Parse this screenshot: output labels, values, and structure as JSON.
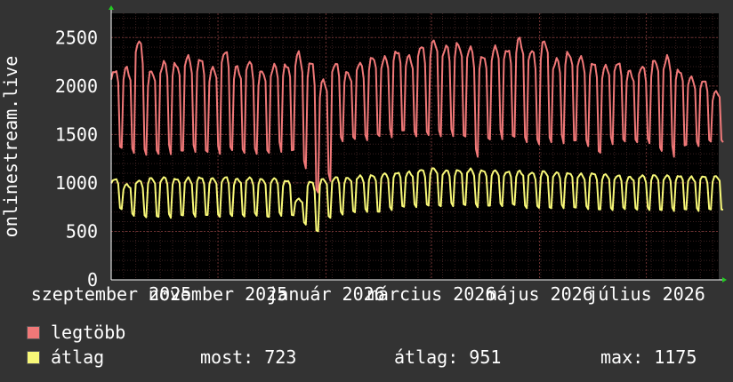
{
  "chart_data": {
    "type": "line",
    "ylabel": "onlinestream.live",
    "ylim": [
      0,
      2750
    ],
    "yticks": [
      0,
      500,
      1000,
      1500,
      2000,
      2500
    ],
    "xticks": [
      "szeptember 2025",
      "november 2025",
      "január 2026",
      "március 2026",
      "május 2026",
      "július 2026"
    ],
    "x_unit": "week",
    "x_range_weeks": [
      0,
      49.5
    ],
    "grid": true,
    "background": "#000000",
    "series": [
      {
        "name": "legtöbb",
        "color": "#f07878",
        "weekly_peak": [
          2180,
          2200,
          2460,
          2150,
          2260,
          2250,
          2320,
          2270,
          2200,
          2380,
          2210,
          2250,
          2150,
          2230,
          2240,
          2360,
          2240,
          2070,
          2250,
          2150,
          2240,
          2290,
          2310,
          2380,
          2320,
          2400,
          2470,
          2430,
          2450,
          2410,
          2300,
          2420,
          2400,
          2500,
          2360,
          2460,
          2290,
          2360,
          2310,
          2230,
          2220,
          2260,
          2160,
          2200,
          2260,
          2320,
          2180,
          2100,
          2050,
          1950
        ],
        "weekly_low": [
          1320,
          1310,
          1290,
          1300,
          1290,
          1300,
          1320,
          1310,
          1300,
          1290,
          1310,
          1300,
          1310,
          1320,
          1300,
          1150,
          890,
          1020,
          1400,
          1450,
          1440,
          1480,
          1470,
          1500,
          1480,
          1490,
          1480,
          1460,
          1460,
          1270,
          1440,
          1450,
          1430,
          1420,
          1400,
          1420,
          1400,
          1410,
          1380,
          1300,
          1400,
          1390,
          1420,
          1410,
          1330,
          1270,
          1360,
          1380,
          1420,
          1400
        ],
        "final_value": 1420
      },
      {
        "name": "átlag",
        "color": "#f8f878",
        "weekly_peak": [
          1040,
          990,
          1030,
          1050,
          1060,
          1050,
          1060,
          1060,
          1050,
          1060,
          1050,
          1060,
          1040,
          1050,
          1030,
          840,
          1020,
          1040,
          1060,
          1060,
          1080,
          1080,
          1100,
          1110,
          1120,
          1140,
          1150,
          1130,
          1140,
          1150,
          1130,
          1130,
          1120,
          1130,
          1110,
          1120,
          1110,
          1110,
          1100,
          1100,
          1090,
          1080,
          1070,
          1080,
          1080,
          1080,
          1080,
          1070,
          1070,
          1070
        ],
        "weekly_low": [
          720,
          660,
          640,
          650,
          640,
          650,
          650,
          660,
          650,
          650,
          650,
          660,
          650,
          660,
          650,
          570,
          490,
          640,
          670,
          690,
          700,
          700,
          720,
          740,
          750,
          760,
          760,
          760,
          760,
          750,
          760,
          760,
          760,
          740,
          740,
          740,
          740,
          730,
          730,
          720,
          720,
          720,
          720,
          720,
          720,
          710,
          710,
          710,
          720,
          710
        ],
        "final_value": 723
      }
    ]
  },
  "legend": {
    "items": [
      {
        "label": "legtöbb",
        "color": "#f07878"
      },
      {
        "label": "átlag",
        "color": "#f8f878"
      }
    ]
  },
  "stats": {
    "now": "most: 723",
    "avg": "átlag: 951",
    "max": "max: 1175"
  }
}
